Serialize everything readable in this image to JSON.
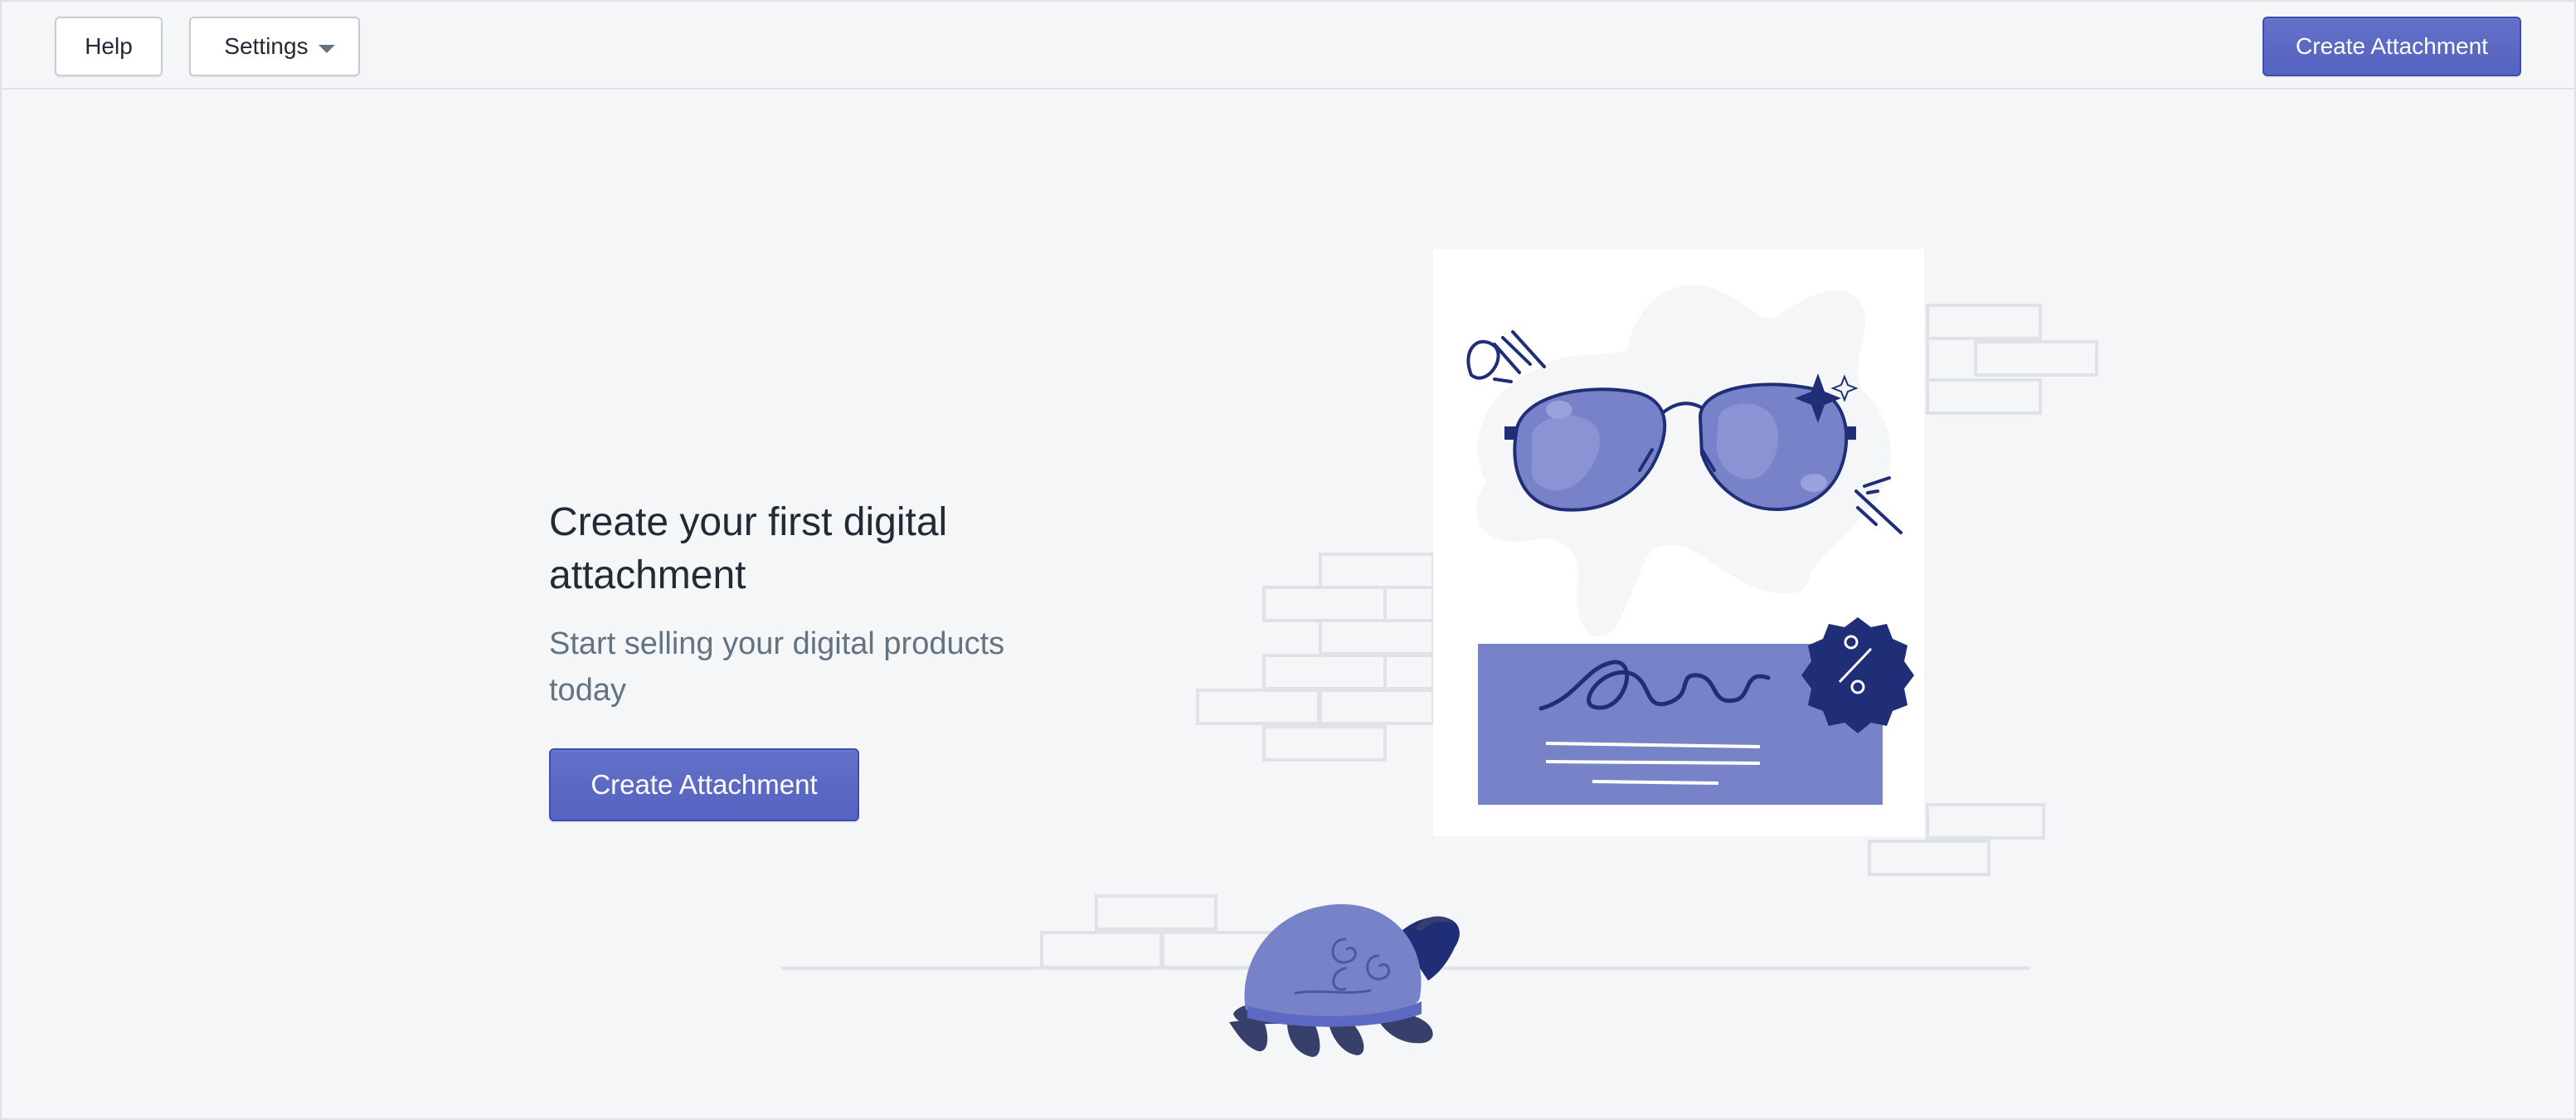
{
  "topbar": {
    "help_label": "Help",
    "settings_label": "Settings",
    "create_label": "Create Attachment"
  },
  "empty_state": {
    "heading": "Create your first digital attachment",
    "subheading": "Start selling your digital products today",
    "cta_label": "Create Attachment"
  },
  "colors": {
    "primary": "#5c6ac4",
    "primary_dark": "#202e78",
    "illustration_blue": "#7782c9",
    "background": "#f4f6f8"
  },
  "icons": {
    "settings_dropdown": "caret-down-icon"
  }
}
